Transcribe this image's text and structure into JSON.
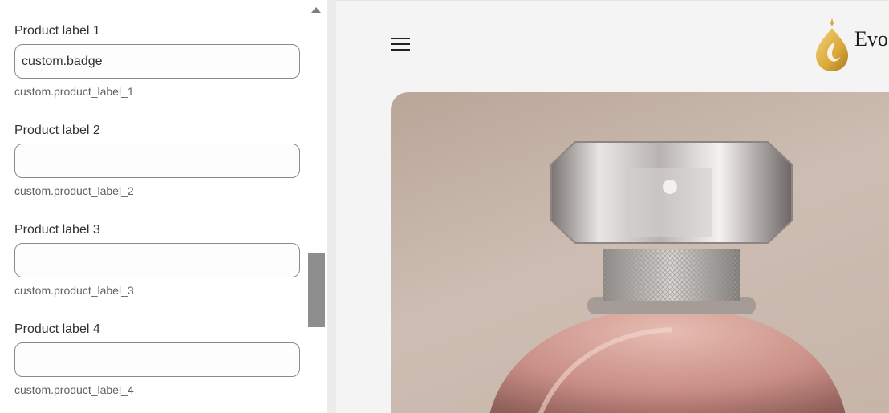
{
  "settings": {
    "fields": [
      {
        "label": "Product label 1",
        "value": "custom.badge",
        "help": "custom.product_label_1"
      },
      {
        "label": "Product label 2",
        "value": "",
        "help": "custom.product_label_2"
      },
      {
        "label": "Product label 3",
        "value": "",
        "help": "custom.product_label_3"
      },
      {
        "label": "Product label 4",
        "value": "",
        "help": "custom.product_label_4"
      }
    ]
  },
  "preview": {
    "brand_text": "Evo",
    "icons": {
      "menu": "hamburger-icon",
      "logo": "flame-drop-logo"
    },
    "colors": {
      "logo_gold": "#d9a93a",
      "panel_bg": "#ffffff",
      "preview_bg": "#f4f4f4"
    }
  }
}
